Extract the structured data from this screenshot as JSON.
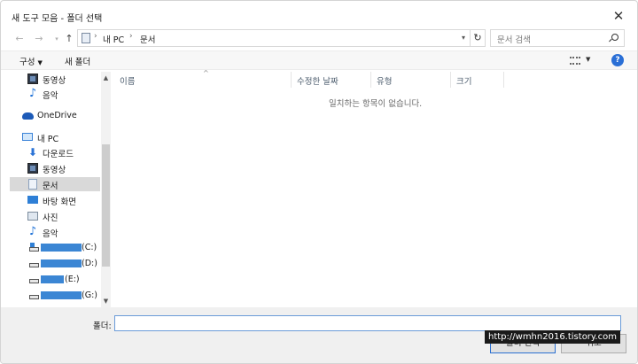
{
  "window": {
    "title": "새 도구 모음 - 폴더 선택"
  },
  "address": {
    "crumbs": [
      "내 PC",
      "문서"
    ],
    "search_placeholder": "문서 검색"
  },
  "toolbar": {
    "organize_label": "구성",
    "new_folder_label": "새 폴더"
  },
  "nav": {
    "items": [
      {
        "label": "동영상",
        "icon": "video-icon"
      },
      {
        "label": "음악",
        "icon": "music-icon"
      },
      {
        "label": "OneDrive",
        "icon": "onedrive-icon"
      },
      {
        "label": "내 PC",
        "icon": "pc-icon"
      },
      {
        "label": "다운로드",
        "icon": "download-icon"
      },
      {
        "label": "동영상",
        "icon": "video-icon"
      },
      {
        "label": "문서",
        "icon": "documents-icon",
        "selected": true
      },
      {
        "label": "바탕 화면",
        "icon": "desktop-icon"
      },
      {
        "label": "사진",
        "icon": "pictures-icon"
      },
      {
        "label": "음악",
        "icon": "music-icon"
      },
      {
        "label": "(C:)",
        "icon": "drive-icon"
      },
      {
        "label": "(D:)",
        "icon": "drive-icon"
      },
      {
        "label": "(E:)",
        "icon": "drive-icon"
      },
      {
        "label": "(G:)",
        "icon": "drive-icon"
      }
    ]
  },
  "filelist": {
    "columns": [
      "이름",
      "수정한 날짜",
      "유형",
      "크기"
    ],
    "empty_message": "일치하는 항목이 없습니다."
  },
  "footer": {
    "folder_label": "폴더:",
    "folder_value": "",
    "select_folder_label": "폴더 선택",
    "cancel_label": "취소"
  },
  "watermark": "http://wmhn2016.tistory.com",
  "colors": {
    "accent": "#2a6fd6",
    "selected_bg": "#d9d9d9",
    "input_border": "#6a9bd8"
  }
}
